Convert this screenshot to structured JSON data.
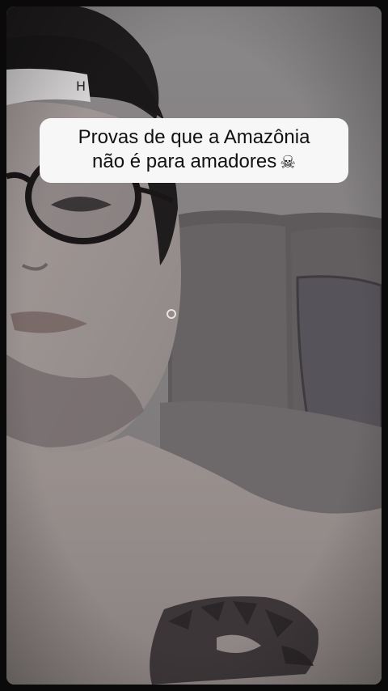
{
  "caption": {
    "line1": "Provas de que a Amazônia",
    "line2": "não é para amadores",
    "emoji": "☠",
    "emoji_icon": "skull-crossbones-icon"
  },
  "colors": {
    "caption_bg": "#f7f7f7",
    "caption_text": "#111111",
    "frame_border": "#0a0a0a"
  }
}
